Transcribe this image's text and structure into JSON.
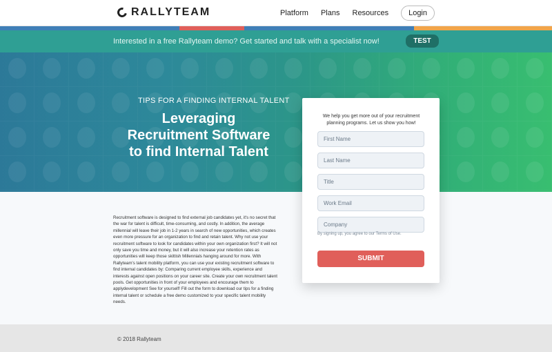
{
  "header": {
    "logo_text": "RALLYTEAM",
    "nav": [
      {
        "label": "Platform"
      },
      {
        "label": "Plans"
      },
      {
        "label": "Resources"
      }
    ],
    "login_label": "Login"
  },
  "stripe_colors": [
    "#3f7fb7",
    "#3f7fb7",
    "#e05f5a",
    "#3f7fb7",
    "#f2a54a"
  ],
  "promo": {
    "text": "Interested in a free Rallyteam demo? Get started and talk with a specialist now!",
    "button_label": "TEST"
  },
  "hero": {
    "kicker": "TIPS FOR A FINDING INTERNAL TALENT",
    "title": "Leveraging Recruitment Software to find Internal Talent"
  },
  "form": {
    "intro": "We help you get more out of your recruitment planning programs. Let us show you how!",
    "fields": [
      {
        "placeholder": "First Name"
      },
      {
        "placeholder": "Last Name"
      },
      {
        "placeholder": "Title"
      },
      {
        "placeholder": "Work Email"
      },
      {
        "placeholder": "Company"
      }
    ],
    "terms": "By signing up, you agree to our Terms of Use.",
    "submit_label": "SUBMIT"
  },
  "content": {
    "body": "Recruitment software is designed to find external job candidates yet, it's no secret that the war for talent is difficult, time-consuming, and costly. In addition, the average millennial will leave their job in 1-2 years in search of new opportunities, which creates even more pressure for an organization to find and retain talent. Why not use your recruitment software to look for candidates within your own organization first? It will not only save you time and money, but it will also increase your retention rates as opportunities will keep those skittish Millennials hanging around for more. With Rallyteam's talent mobility platform, you can use your existing recruitment software to find internal candidates by: Comparing current employee skills, experience and interests against open positions on your career site. Create your own recruitment talent pools. Get opportunities in front of your employees and encourage them to applydevelopment See for yourself! Fill out the form to download our tips for a finding internal talent or schedule a free demo customized to your specific talent mobility needs."
  },
  "footer": {
    "copyright": "© 2018 Rallyteam"
  }
}
